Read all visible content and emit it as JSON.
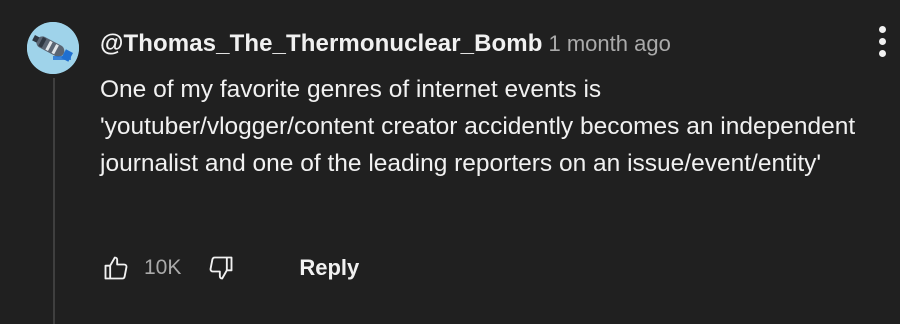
{
  "comment": {
    "author": "@Thomas_The_Thermonuclear_Bomb",
    "timestamp": "1 month ago",
    "text": "One of my favorite genres of internet events is 'youtuber/vlogger/content creator accidently becomes an independent journalist and one of the leading reporters on an issue/event/entity'",
    "avatar": "thermonuclear-bomb-avatar"
  },
  "actions": {
    "like_icon": "thumbs-up-icon",
    "like_count": "10K",
    "dislike_icon": "thumbs-down-icon",
    "reply_label": "Reply"
  },
  "menu": {
    "icon": "more-vertical-icon"
  },
  "colors": {
    "background": "#202020",
    "primary_text": "#f1f1f1",
    "secondary_text": "#aaaaaa",
    "avatar_bg": "#9fd3ea"
  }
}
